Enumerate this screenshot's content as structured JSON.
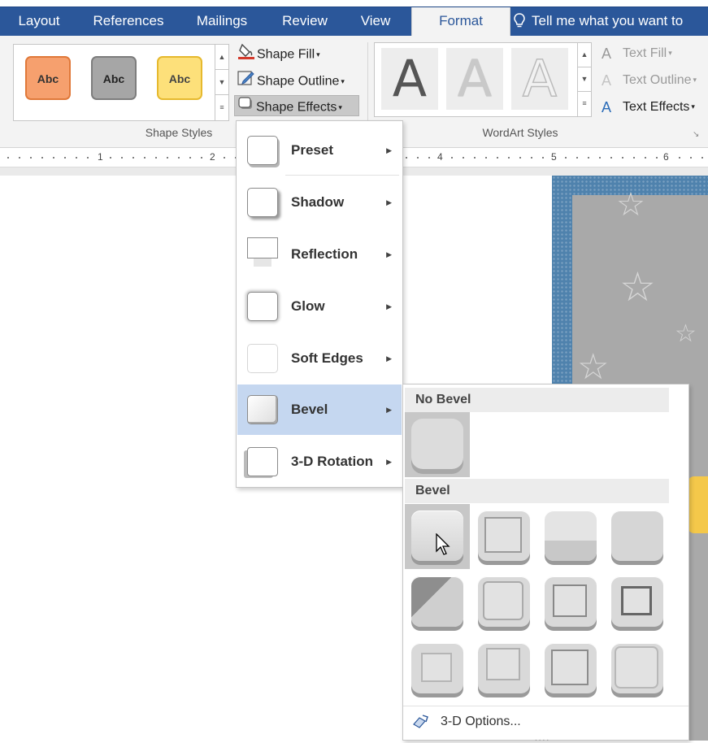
{
  "tabs": [
    {
      "label": "Layout",
      "active": false
    },
    {
      "label": "References",
      "active": false
    },
    {
      "label": "Mailings",
      "active": false
    },
    {
      "label": "Review",
      "active": false
    },
    {
      "label": "View",
      "active": false
    },
    {
      "label": "Format",
      "active": true
    }
  ],
  "tell_me": "Tell me what you want to",
  "shape_styles": {
    "thumbnails": [
      {
        "label": "Abc",
        "color": "#f6a06e"
      },
      {
        "label": "Abc",
        "color": "#a6a6a6"
      },
      {
        "label": "Abc",
        "color": "#fde07a"
      }
    ],
    "group_label": "Shape Styles",
    "shape_fill": "Shape Fill",
    "shape_outline": "Shape Outline",
    "shape_effects": "Shape Effects"
  },
  "wordart_styles": {
    "group_label": "WordArt Styles",
    "samples": [
      "A",
      "A",
      "A"
    ],
    "text_fill": "Text Fill",
    "text_outline": "Text Outline",
    "text_effects": "Text Effects"
  },
  "ruler": {
    "numbers": [
      "1",
      "2",
      "4",
      "5",
      "6"
    ]
  },
  "shape_effects_menu": {
    "items": [
      {
        "label": "Preset",
        "highlighted": false
      },
      {
        "label": "Shadow",
        "highlighted": false
      },
      {
        "label": "Reflection",
        "highlighted": false
      },
      {
        "label": "Glow",
        "highlighted": false
      },
      {
        "label": "Soft Edges",
        "highlighted": false
      },
      {
        "label": "Bevel",
        "highlighted": true
      },
      {
        "label": "3-D Rotation",
        "highlighted": false
      }
    ]
  },
  "bevel_submenu": {
    "no_bevel_header": "No Bevel",
    "bevel_header": "Bevel",
    "options_label": "3-D Options...",
    "selected_index": 0,
    "option_count": 12
  },
  "colors": {
    "tab_bar": "#2b579a",
    "menu_highlight": "#c5d7f0",
    "picture_border": "#4f82ad"
  }
}
